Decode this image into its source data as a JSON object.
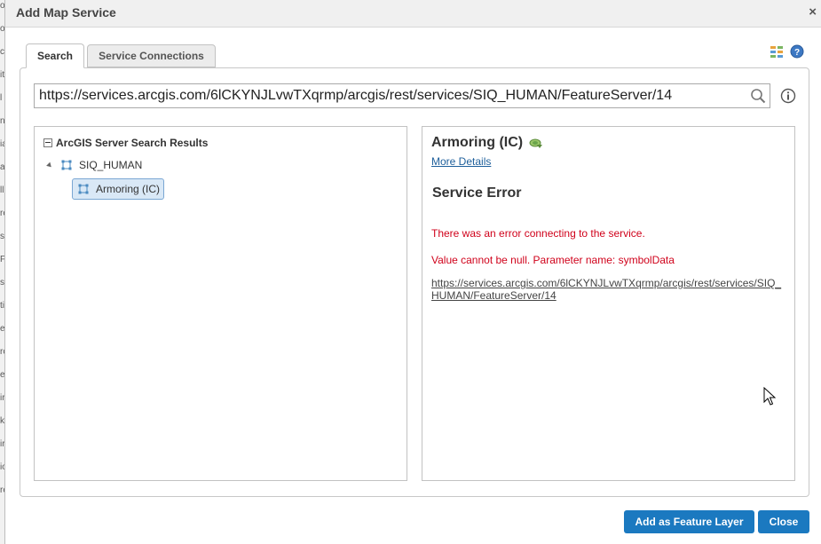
{
  "dialog": {
    "title": "Add Map Service",
    "close_glyph": "×"
  },
  "tabs": [
    {
      "label": "Search",
      "active": true
    },
    {
      "label": "Service Connections",
      "active": false
    }
  ],
  "toolbar_icons": [
    "grid-view-icon",
    "help-icon"
  ],
  "search": {
    "url_value": "https://services.arcgis.com/6lCKYNJLvwTXqrmp/arcgis/rest/services/SIQ_HUMAN/FeatureServer/14",
    "search_icon": "search-icon",
    "info_icon": "info-icon"
  },
  "tree": {
    "root_label": "ArcGIS Server Search Results",
    "service_label": "SIQ_HUMAN",
    "layer_label": "Armoring (IC)"
  },
  "details": {
    "layer_title": "Armoring (IC)",
    "more_details": "More Details",
    "error_heading": "Service Error",
    "error_message": "There was an error connecting to the service.",
    "error_detail": "Value cannot be null. Parameter name: symbolData",
    "error_url": "https://services.arcgis.com/6lCKYNJLvwTXqrmp/arcgis/rest/services/SIQ_HUMAN/FeatureServer/14"
  },
  "buttons": {
    "add_feature_layer": "Add as Feature Layer",
    "close": "Close"
  },
  "colors": {
    "button_blue": "#1b79c0",
    "error_red": "#d0021b",
    "link_blue": "#1e5f9b",
    "selection_bg": "#d9e8f6"
  },
  "background_letters": [
    "o",
    "o",
    "ch",
    "ite",
    "l",
    "ns",
    "ia",
    "all",
    "ll",
    "re",
    "s",
    "F",
    "s",
    "ti",
    "ed",
    "ro",
    "e",
    "ir",
    "k",
    "ir",
    "io",
    "re"
  ]
}
